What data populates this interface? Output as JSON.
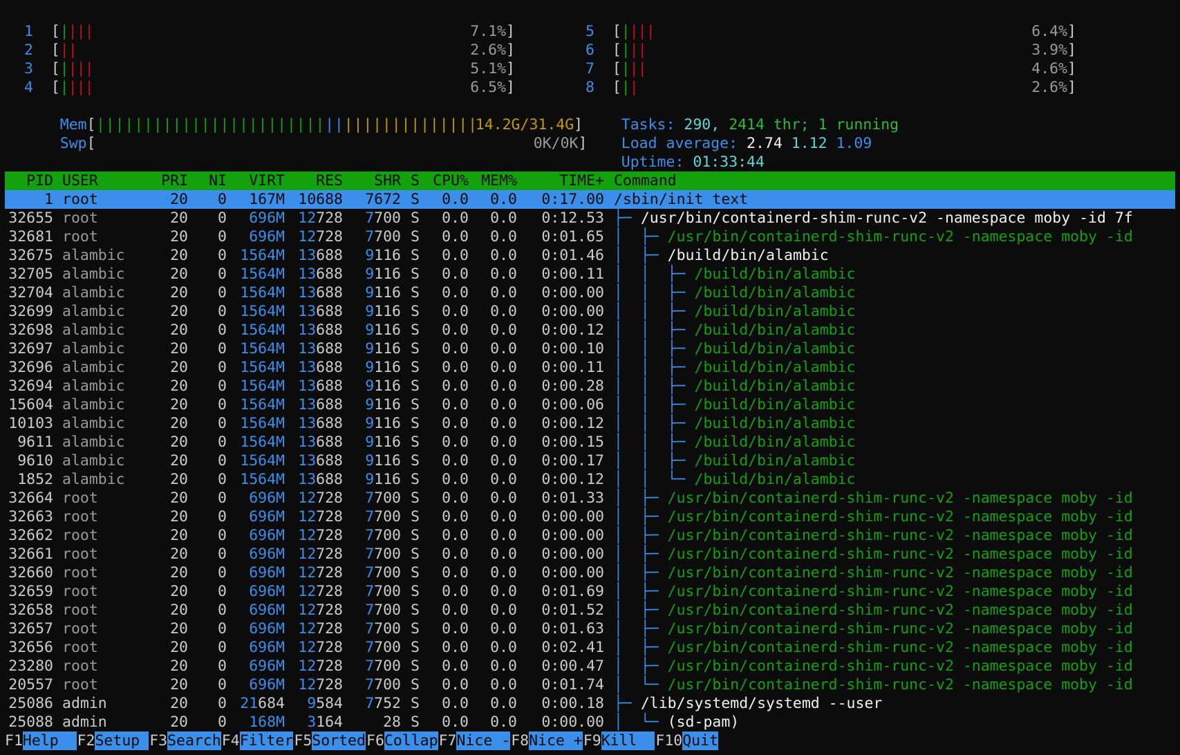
{
  "cpus": [
    {
      "id": "1",
      "value": "7.1%",
      "bars": [
        "g",
        "r",
        "r",
        "r"
      ]
    },
    {
      "id": "2",
      "value": "2.6%",
      "bars": [
        "r",
        "r"
      ]
    },
    {
      "id": "3",
      "value": "5.1%",
      "bars": [
        "g",
        "r",
        "r",
        "r"
      ]
    },
    {
      "id": "4",
      "value": "6.5%",
      "bars": [
        "g",
        "r",
        "r",
        "r"
      ]
    },
    {
      "id": "5",
      "value": "6.4%",
      "bars": [
        "g",
        "r",
        "r",
        "r"
      ]
    },
    {
      "id": "6",
      "value": "3.9%",
      "bars": [
        "g",
        "r",
        "r"
      ]
    },
    {
      "id": "7",
      "value": "4.6%",
      "bars": [
        "g",
        "r",
        "r"
      ]
    },
    {
      "id": "8",
      "value": "2.6%",
      "bars": [
        "g",
        "r"
      ]
    }
  ],
  "mem": {
    "label": "Mem",
    "value": "14.2G/31.4G",
    "green": 24,
    "blue": 2,
    "yellow": 14
  },
  "swp": {
    "label": "Swp",
    "value": "0K/0K"
  },
  "tasks": {
    "label": "Tasks:",
    "count": "290,",
    "thr": "2414 thr;",
    "running": "1 running"
  },
  "load": {
    "label": "Load average:",
    "l1": "2.74",
    "l5": "1.12",
    "l15": "1.09"
  },
  "uptime": {
    "label": "Uptime:",
    "value": "01:33:44"
  },
  "columns": [
    "PID",
    "USER",
    "PRI",
    "NI",
    "VIRT",
    "RES",
    "SHR",
    "S",
    "CPU%",
    "MEM%",
    "TIME+",
    "Command"
  ],
  "rows": [
    {
      "pid": "1",
      "user": "root",
      "pri": "20",
      "ni": "0",
      "virt": "167M",
      "res": "10688",
      "shr": "7672",
      "s": "S",
      "cpu": "0.0",
      "mem": "0.0",
      "time": "0:17.00",
      "tree": "",
      "cmd": "/sbin/init text",
      "selected": true
    },
    {
      "pid": "32655",
      "user": "root",
      "pri": "20",
      "ni": "0",
      "virt": "696M",
      "res": "12728",
      "shr": "7700",
      "s": "S",
      "cpu": "0.0",
      "mem": "0.0",
      "time": "0:12.53",
      "tree": "├─ ",
      "cmd": "/usr/bin/containerd-shim-runc-v2 -namespace moby -id 7f",
      "cmdc": "white"
    },
    {
      "pid": "32681",
      "user": "root",
      "pri": "20",
      "ni": "0",
      "virt": "696M",
      "res": "12728",
      "shr": "7700",
      "s": "S",
      "cpu": "0.0",
      "mem": "0.0",
      "time": "0:01.65",
      "tree": "│  ├─ ",
      "cmd": "/usr/bin/containerd-shim-runc-v2 -namespace moby -id",
      "cmdc": "green"
    },
    {
      "pid": "32675",
      "user": "alambic",
      "pri": "20",
      "ni": "0",
      "virt": "1564M",
      "res": "13688",
      "shr": "9116",
      "s": "S",
      "cpu": "0.0",
      "mem": "0.0",
      "time": "0:01.46",
      "tree": "│  ├─ ",
      "cmd": "/build/bin/alambic",
      "cmdc": "white"
    },
    {
      "pid": "32705",
      "user": "alambic",
      "pri": "20",
      "ni": "0",
      "virt": "1564M",
      "res": "13688",
      "shr": "9116",
      "s": "S",
      "cpu": "0.0",
      "mem": "0.0",
      "time": "0:00.11",
      "tree": "│  │  ├─ ",
      "cmd": "/build/bin/alambic",
      "cmdc": "green"
    },
    {
      "pid": "32704",
      "user": "alambic",
      "pri": "20",
      "ni": "0",
      "virt": "1564M",
      "res": "13688",
      "shr": "9116",
      "s": "S",
      "cpu": "0.0",
      "mem": "0.0",
      "time": "0:00.00",
      "tree": "│  │  ├─ ",
      "cmd": "/build/bin/alambic",
      "cmdc": "green"
    },
    {
      "pid": "32699",
      "user": "alambic",
      "pri": "20",
      "ni": "0",
      "virt": "1564M",
      "res": "13688",
      "shr": "9116",
      "s": "S",
      "cpu": "0.0",
      "mem": "0.0",
      "time": "0:00.00",
      "tree": "│  │  ├─ ",
      "cmd": "/build/bin/alambic",
      "cmdc": "green"
    },
    {
      "pid": "32698",
      "user": "alambic",
      "pri": "20",
      "ni": "0",
      "virt": "1564M",
      "res": "13688",
      "shr": "9116",
      "s": "S",
      "cpu": "0.0",
      "mem": "0.0",
      "time": "0:00.12",
      "tree": "│  │  ├─ ",
      "cmd": "/build/bin/alambic",
      "cmdc": "green"
    },
    {
      "pid": "32697",
      "user": "alambic",
      "pri": "20",
      "ni": "0",
      "virt": "1564M",
      "res": "13688",
      "shr": "9116",
      "s": "S",
      "cpu": "0.0",
      "mem": "0.0",
      "time": "0:00.10",
      "tree": "│  │  ├─ ",
      "cmd": "/build/bin/alambic",
      "cmdc": "green"
    },
    {
      "pid": "32696",
      "user": "alambic",
      "pri": "20",
      "ni": "0",
      "virt": "1564M",
      "res": "13688",
      "shr": "9116",
      "s": "S",
      "cpu": "0.0",
      "mem": "0.0",
      "time": "0:00.11",
      "tree": "│  │  ├─ ",
      "cmd": "/build/bin/alambic",
      "cmdc": "green"
    },
    {
      "pid": "32694",
      "user": "alambic",
      "pri": "20",
      "ni": "0",
      "virt": "1564M",
      "res": "13688",
      "shr": "9116",
      "s": "S",
      "cpu": "0.0",
      "mem": "0.0",
      "time": "0:00.28",
      "tree": "│  │  ├─ ",
      "cmd": "/build/bin/alambic",
      "cmdc": "green"
    },
    {
      "pid": "15604",
      "user": "alambic",
      "pri": "20",
      "ni": "0",
      "virt": "1564M",
      "res": "13688",
      "shr": "9116",
      "s": "S",
      "cpu": "0.0",
      "mem": "0.0",
      "time": "0:00.06",
      "tree": "│  │  ├─ ",
      "cmd": "/build/bin/alambic",
      "cmdc": "green"
    },
    {
      "pid": "10103",
      "user": "alambic",
      "pri": "20",
      "ni": "0",
      "virt": "1564M",
      "res": "13688",
      "shr": "9116",
      "s": "S",
      "cpu": "0.0",
      "mem": "0.0",
      "time": "0:00.12",
      "tree": "│  │  ├─ ",
      "cmd": "/build/bin/alambic",
      "cmdc": "green"
    },
    {
      "pid": "9611",
      "user": "alambic",
      "pri": "20",
      "ni": "0",
      "virt": "1564M",
      "res": "13688",
      "shr": "9116",
      "s": "S",
      "cpu": "0.0",
      "mem": "0.0",
      "time": "0:00.15",
      "tree": "│  │  ├─ ",
      "cmd": "/build/bin/alambic",
      "cmdc": "green"
    },
    {
      "pid": "9610",
      "user": "alambic",
      "pri": "20",
      "ni": "0",
      "virt": "1564M",
      "res": "13688",
      "shr": "9116",
      "s": "S",
      "cpu": "0.0",
      "mem": "0.0",
      "time": "0:00.17",
      "tree": "│  │  ├─ ",
      "cmd": "/build/bin/alambic",
      "cmdc": "green"
    },
    {
      "pid": "1852",
      "user": "alambic",
      "pri": "20",
      "ni": "0",
      "virt": "1564M",
      "res": "13688",
      "shr": "9116",
      "s": "S",
      "cpu": "0.0",
      "mem": "0.0",
      "time": "0:00.12",
      "tree": "│  │  └─ ",
      "cmd": "/build/bin/alambic",
      "cmdc": "green"
    },
    {
      "pid": "32664",
      "user": "root",
      "pri": "20",
      "ni": "0",
      "virt": "696M",
      "res": "12728",
      "shr": "7700",
      "s": "S",
      "cpu": "0.0",
      "mem": "0.0",
      "time": "0:01.33",
      "tree": "│  ├─ ",
      "cmd": "/usr/bin/containerd-shim-runc-v2 -namespace moby -id",
      "cmdc": "green"
    },
    {
      "pid": "32663",
      "user": "root",
      "pri": "20",
      "ni": "0",
      "virt": "696M",
      "res": "12728",
      "shr": "7700",
      "s": "S",
      "cpu": "0.0",
      "mem": "0.0",
      "time": "0:00.00",
      "tree": "│  ├─ ",
      "cmd": "/usr/bin/containerd-shim-runc-v2 -namespace moby -id",
      "cmdc": "green"
    },
    {
      "pid": "32662",
      "user": "root",
      "pri": "20",
      "ni": "0",
      "virt": "696M",
      "res": "12728",
      "shr": "7700",
      "s": "S",
      "cpu": "0.0",
      "mem": "0.0",
      "time": "0:00.00",
      "tree": "│  ├─ ",
      "cmd": "/usr/bin/containerd-shim-runc-v2 -namespace moby -id",
      "cmdc": "green"
    },
    {
      "pid": "32661",
      "user": "root",
      "pri": "20",
      "ni": "0",
      "virt": "696M",
      "res": "12728",
      "shr": "7700",
      "s": "S",
      "cpu": "0.0",
      "mem": "0.0",
      "time": "0:00.00",
      "tree": "│  ├─ ",
      "cmd": "/usr/bin/containerd-shim-runc-v2 -namespace moby -id",
      "cmdc": "green"
    },
    {
      "pid": "32660",
      "user": "root",
      "pri": "20",
      "ni": "0",
      "virt": "696M",
      "res": "12728",
      "shr": "7700",
      "s": "S",
      "cpu": "0.0",
      "mem": "0.0",
      "time": "0:00.00",
      "tree": "│  ├─ ",
      "cmd": "/usr/bin/containerd-shim-runc-v2 -namespace moby -id",
      "cmdc": "green"
    },
    {
      "pid": "32659",
      "user": "root",
      "pri": "20",
      "ni": "0",
      "virt": "696M",
      "res": "12728",
      "shr": "7700",
      "s": "S",
      "cpu": "0.0",
      "mem": "0.0",
      "time": "0:01.69",
      "tree": "│  ├─ ",
      "cmd": "/usr/bin/containerd-shim-runc-v2 -namespace moby -id",
      "cmdc": "green"
    },
    {
      "pid": "32658",
      "user": "root",
      "pri": "20",
      "ni": "0",
      "virt": "696M",
      "res": "12728",
      "shr": "7700",
      "s": "S",
      "cpu": "0.0",
      "mem": "0.0",
      "time": "0:01.52",
      "tree": "│  ├─ ",
      "cmd": "/usr/bin/containerd-shim-runc-v2 -namespace moby -id",
      "cmdc": "green"
    },
    {
      "pid": "32657",
      "user": "root",
      "pri": "20",
      "ni": "0",
      "virt": "696M",
      "res": "12728",
      "shr": "7700",
      "s": "S",
      "cpu": "0.0",
      "mem": "0.0",
      "time": "0:01.63",
      "tree": "│  ├─ ",
      "cmd": "/usr/bin/containerd-shim-runc-v2 -namespace moby -id",
      "cmdc": "green"
    },
    {
      "pid": "32656",
      "user": "root",
      "pri": "20",
      "ni": "0",
      "virt": "696M",
      "res": "12728",
      "shr": "7700",
      "s": "S",
      "cpu": "0.0",
      "mem": "0.0",
      "time": "0:02.41",
      "tree": "│  ├─ ",
      "cmd": "/usr/bin/containerd-shim-runc-v2 -namespace moby -id",
      "cmdc": "green"
    },
    {
      "pid": "23280",
      "user": "root",
      "pri": "20",
      "ni": "0",
      "virt": "696M",
      "res": "12728",
      "shr": "7700",
      "s": "S",
      "cpu": "0.0",
      "mem": "0.0",
      "time": "0:00.47",
      "tree": "│  ├─ ",
      "cmd": "/usr/bin/containerd-shim-runc-v2 -namespace moby -id",
      "cmdc": "green"
    },
    {
      "pid": "20557",
      "user": "root",
      "pri": "20",
      "ni": "0",
      "virt": "696M",
      "res": "12728",
      "shr": "7700",
      "s": "S",
      "cpu": "0.0",
      "mem": "0.0",
      "time": "0:01.74",
      "tree": "│  └─ ",
      "cmd": "/usr/bin/containerd-shim-runc-v2 -namespace moby -id",
      "cmdc": "green"
    },
    {
      "pid": "25086",
      "user": "admin",
      "pri": "20",
      "ni": "0",
      "virt": "21684",
      "res": "9584",
      "shr": "7752",
      "s": "S",
      "cpu": "0.0",
      "mem": "0.0",
      "time": "0:00.18",
      "tree": "├─ ",
      "cmd": "/lib/systemd/systemd --user",
      "cmdc": "white"
    },
    {
      "pid": "25088",
      "user": "admin",
      "pri": "20",
      "ni": "0",
      "virt": "168M",
      "res": "3164",
      "shr": "28",
      "s": "S",
      "cpu": "0.0",
      "mem": "0.0",
      "time": "0:00.00",
      "tree": "│  └─ ",
      "cmd": "(sd-pam)",
      "cmdc": "white"
    }
  ],
  "footer": [
    {
      "key": "F1",
      "label": "Help  "
    },
    {
      "key": "F2",
      "label": "Setup "
    },
    {
      "key": "F3",
      "label": "Search"
    },
    {
      "key": "F4",
      "label": "Filter"
    },
    {
      "key": "F5",
      "label": "Sorted"
    },
    {
      "key": "F6",
      "label": "Collap"
    },
    {
      "key": "F7",
      "label": "Nice -"
    },
    {
      "key": "F8",
      "label": "Nice +"
    },
    {
      "key": "F9",
      "label": "Kill  "
    },
    {
      "key": "F10",
      "label": "Quit"
    }
  ]
}
